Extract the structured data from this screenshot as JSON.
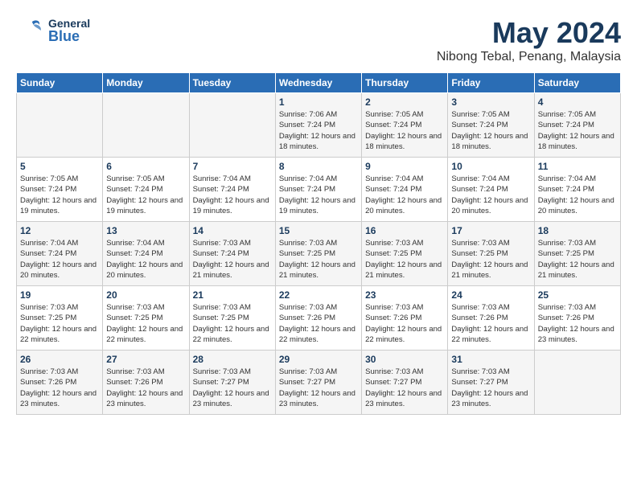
{
  "header": {
    "logo_general": "General",
    "logo_blue": "Blue",
    "title": "May 2024",
    "subtitle": "Nibong Tebal, Penang, Malaysia"
  },
  "days_of_week": [
    "Sunday",
    "Monday",
    "Tuesday",
    "Wednesday",
    "Thursday",
    "Friday",
    "Saturday"
  ],
  "weeks": [
    [
      {
        "day": "",
        "info": ""
      },
      {
        "day": "",
        "info": ""
      },
      {
        "day": "",
        "info": ""
      },
      {
        "day": "1",
        "info": "Sunrise: 7:06 AM\nSunset: 7:24 PM\nDaylight: 12 hours\nand 18 minutes."
      },
      {
        "day": "2",
        "info": "Sunrise: 7:05 AM\nSunset: 7:24 PM\nDaylight: 12 hours\nand 18 minutes."
      },
      {
        "day": "3",
        "info": "Sunrise: 7:05 AM\nSunset: 7:24 PM\nDaylight: 12 hours\nand 18 minutes."
      },
      {
        "day": "4",
        "info": "Sunrise: 7:05 AM\nSunset: 7:24 PM\nDaylight: 12 hours\nand 18 minutes."
      }
    ],
    [
      {
        "day": "5",
        "info": "Sunrise: 7:05 AM\nSunset: 7:24 PM\nDaylight: 12 hours\nand 19 minutes."
      },
      {
        "day": "6",
        "info": "Sunrise: 7:05 AM\nSunset: 7:24 PM\nDaylight: 12 hours\nand 19 minutes."
      },
      {
        "day": "7",
        "info": "Sunrise: 7:04 AM\nSunset: 7:24 PM\nDaylight: 12 hours\nand 19 minutes."
      },
      {
        "day": "8",
        "info": "Sunrise: 7:04 AM\nSunset: 7:24 PM\nDaylight: 12 hours\nand 19 minutes."
      },
      {
        "day": "9",
        "info": "Sunrise: 7:04 AM\nSunset: 7:24 PM\nDaylight: 12 hours\nand 20 minutes."
      },
      {
        "day": "10",
        "info": "Sunrise: 7:04 AM\nSunset: 7:24 PM\nDaylight: 12 hours\nand 20 minutes."
      },
      {
        "day": "11",
        "info": "Sunrise: 7:04 AM\nSunset: 7:24 PM\nDaylight: 12 hours\nand 20 minutes."
      }
    ],
    [
      {
        "day": "12",
        "info": "Sunrise: 7:04 AM\nSunset: 7:24 PM\nDaylight: 12 hours\nand 20 minutes."
      },
      {
        "day": "13",
        "info": "Sunrise: 7:04 AM\nSunset: 7:24 PM\nDaylight: 12 hours\nand 20 minutes."
      },
      {
        "day": "14",
        "info": "Sunrise: 7:03 AM\nSunset: 7:24 PM\nDaylight: 12 hours\nand 21 minutes."
      },
      {
        "day": "15",
        "info": "Sunrise: 7:03 AM\nSunset: 7:25 PM\nDaylight: 12 hours\nand 21 minutes."
      },
      {
        "day": "16",
        "info": "Sunrise: 7:03 AM\nSunset: 7:25 PM\nDaylight: 12 hours\nand 21 minutes."
      },
      {
        "day": "17",
        "info": "Sunrise: 7:03 AM\nSunset: 7:25 PM\nDaylight: 12 hours\nand 21 minutes."
      },
      {
        "day": "18",
        "info": "Sunrise: 7:03 AM\nSunset: 7:25 PM\nDaylight: 12 hours\nand 21 minutes."
      }
    ],
    [
      {
        "day": "19",
        "info": "Sunrise: 7:03 AM\nSunset: 7:25 PM\nDaylight: 12 hours\nand 22 minutes."
      },
      {
        "day": "20",
        "info": "Sunrise: 7:03 AM\nSunset: 7:25 PM\nDaylight: 12 hours\nand 22 minutes."
      },
      {
        "day": "21",
        "info": "Sunrise: 7:03 AM\nSunset: 7:25 PM\nDaylight: 12 hours\nand 22 minutes."
      },
      {
        "day": "22",
        "info": "Sunrise: 7:03 AM\nSunset: 7:26 PM\nDaylight: 12 hours\nand 22 minutes."
      },
      {
        "day": "23",
        "info": "Sunrise: 7:03 AM\nSunset: 7:26 PM\nDaylight: 12 hours\nand 22 minutes."
      },
      {
        "day": "24",
        "info": "Sunrise: 7:03 AM\nSunset: 7:26 PM\nDaylight: 12 hours\nand 22 minutes."
      },
      {
        "day": "25",
        "info": "Sunrise: 7:03 AM\nSunset: 7:26 PM\nDaylight: 12 hours\nand 23 minutes."
      }
    ],
    [
      {
        "day": "26",
        "info": "Sunrise: 7:03 AM\nSunset: 7:26 PM\nDaylight: 12 hours\nand 23 minutes."
      },
      {
        "day": "27",
        "info": "Sunrise: 7:03 AM\nSunset: 7:26 PM\nDaylight: 12 hours\nand 23 minutes."
      },
      {
        "day": "28",
        "info": "Sunrise: 7:03 AM\nSunset: 7:27 PM\nDaylight: 12 hours\nand 23 minutes."
      },
      {
        "day": "29",
        "info": "Sunrise: 7:03 AM\nSunset: 7:27 PM\nDaylight: 12 hours\nand 23 minutes."
      },
      {
        "day": "30",
        "info": "Sunrise: 7:03 AM\nSunset: 7:27 PM\nDaylight: 12 hours\nand 23 minutes."
      },
      {
        "day": "31",
        "info": "Sunrise: 7:03 AM\nSunset: 7:27 PM\nDaylight: 12 hours\nand 23 minutes."
      },
      {
        "day": "",
        "info": ""
      }
    ]
  ]
}
